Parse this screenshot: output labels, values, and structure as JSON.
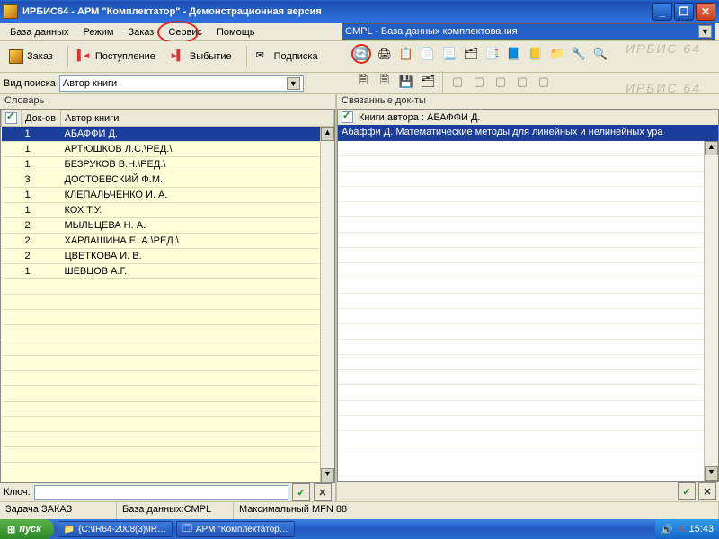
{
  "title": "ИРБИС64 - АРМ \"Комплектатор\" - Демонстрационная версия",
  "menu": {
    "items": [
      "База данных",
      "Режим",
      "Заказ",
      "Сервис",
      "Помощь"
    ]
  },
  "top_db_combo": "CMPL - База данных комплектования",
  "toolbar_left": {
    "order": "Заказ",
    "receipt": "Поступление",
    "disposal": "Выбытие",
    "subscribe": "Подписка"
  },
  "search": {
    "label": "Вид поиска",
    "value": "Автор книги"
  },
  "left_pane": {
    "label": "Словарь",
    "columns": {
      "check": "✓",
      "count": "Док-ов",
      "author": "Автор книги"
    },
    "rows": [
      {
        "count": "1",
        "author": "АБАФФИ Д.",
        "selected": true
      },
      {
        "count": "1",
        "author": "АРТЮШКОВ Л.С.\\РЕД.\\"
      },
      {
        "count": "1",
        "author": "БЕЗРУКОВ В.Н.\\РЕД.\\"
      },
      {
        "count": "3",
        "author": "ДОСТОЕВСКИЙ Ф.М."
      },
      {
        "count": "1",
        "author": "КЛЕПАЛЬЧЕНКО И. А."
      },
      {
        "count": "1",
        "author": "КОХ Т.У."
      },
      {
        "count": "2",
        "author": "МЫЛЬЦЕВА Н. А."
      },
      {
        "count": "2",
        "author": "ХАРЛАШИНА Е. А.\\РЕД.\\"
      },
      {
        "count": "2",
        "author": "ЦВЕТКОВА И. В."
      },
      {
        "count": "1",
        "author": "ШЕВЦОВ А.Г."
      }
    ],
    "key_label": "Ключ:"
  },
  "right_pane": {
    "label": "Связанные док-ты",
    "header": "Книги автора : АБАФФИ Д.",
    "row": "Абаффи Д. Математические методы для линейных и нелинейных ура"
  },
  "status": {
    "task": "Задача:ЗАКАЗ",
    "db": "База данных:CMPL",
    "mfn": "Максимальный MFN 88"
  },
  "taskbar": {
    "start": "пуск",
    "tasks": [
      "{C:\\IR64-2008(3)\\IR…",
      "АРМ \"Комплектатор…"
    ],
    "time": "15:43"
  },
  "brand": "ИРБИС 64",
  "colors": {
    "accent": "#2a6bd0",
    "highlight": "#e0281d"
  }
}
